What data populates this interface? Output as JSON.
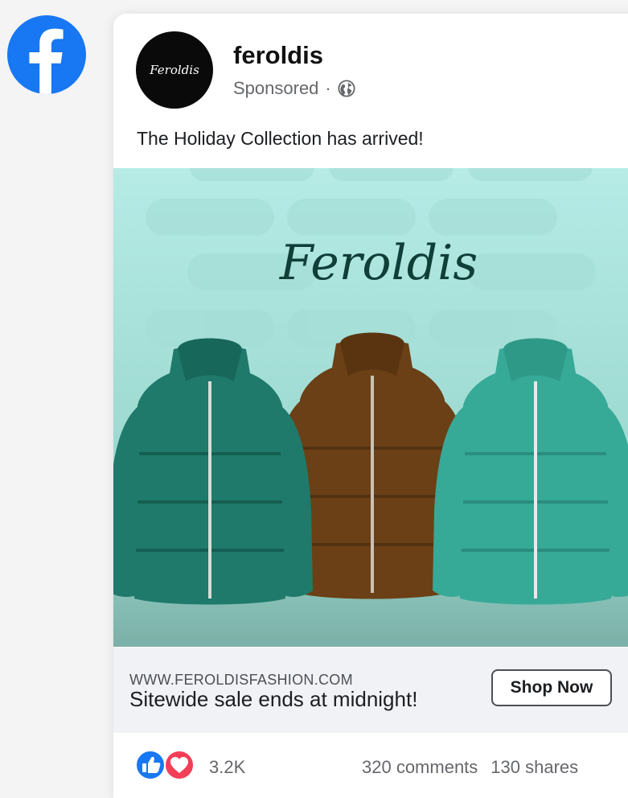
{
  "platform": {
    "icon": "facebook-logo-icon",
    "color": "#1877f2"
  },
  "post": {
    "avatar_text": "Feroldis",
    "page_name": "feroldis",
    "sponsored_label": "Sponsored",
    "separator": "·",
    "privacy_icon": "globe-icon",
    "caption": "The Holiday Collection has arrived!",
    "image": {
      "brand_text": "Feroldis",
      "background_color": "#b0e6e1",
      "jackets": [
        {
          "color": "#1f7a6b",
          "name": "green-jacket"
        },
        {
          "color": "#6b4016",
          "name": "brown-jacket"
        },
        {
          "color": "#37a997",
          "name": "teal-jacket"
        }
      ]
    },
    "ad": {
      "domain": "WWW.FEROLDISFASHION.COM",
      "headline": "Sitewide sale ends at midnight!",
      "cta_label": "Shop Now"
    },
    "reactions": {
      "icons": [
        "like-icon",
        "love-icon"
      ],
      "count": "3.2K",
      "comments": "320 comments",
      "shares": "130 shares"
    }
  }
}
